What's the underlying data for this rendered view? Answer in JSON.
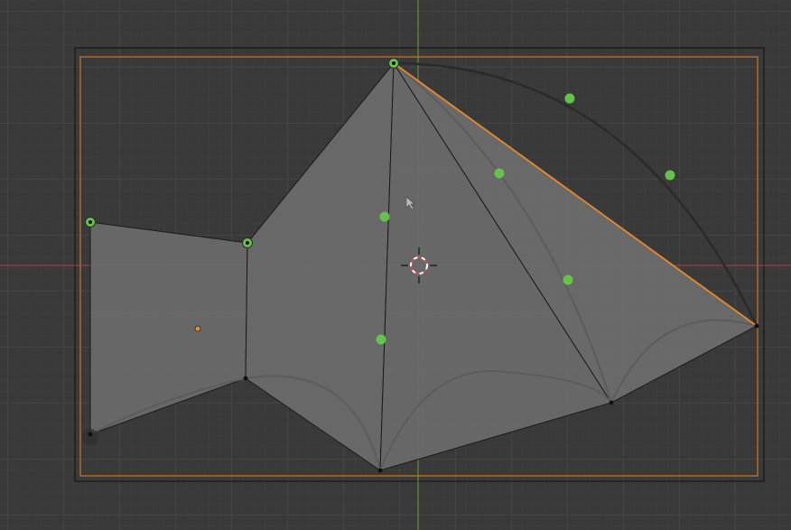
{
  "viewport": {
    "editor": "3D Viewport",
    "view": "top-orthographic",
    "colors": {
      "background": "#393939",
      "x_axis": "#d44a55",
      "y_axis": "#7db542",
      "selection": "#e88a2a",
      "face": "#6a6a6a",
      "vertex_handle": "#66c24a"
    }
  },
  "mesh": {
    "name": "",
    "selected_edge": "top-right",
    "edge_handles": 5,
    "arc_handles": 2,
    "face_handles": 3
  },
  "icons": {
    "cursor": "3d-cursor-icon",
    "origin": "object-origin-icon",
    "pointer": "mouse-pointer-icon"
  }
}
